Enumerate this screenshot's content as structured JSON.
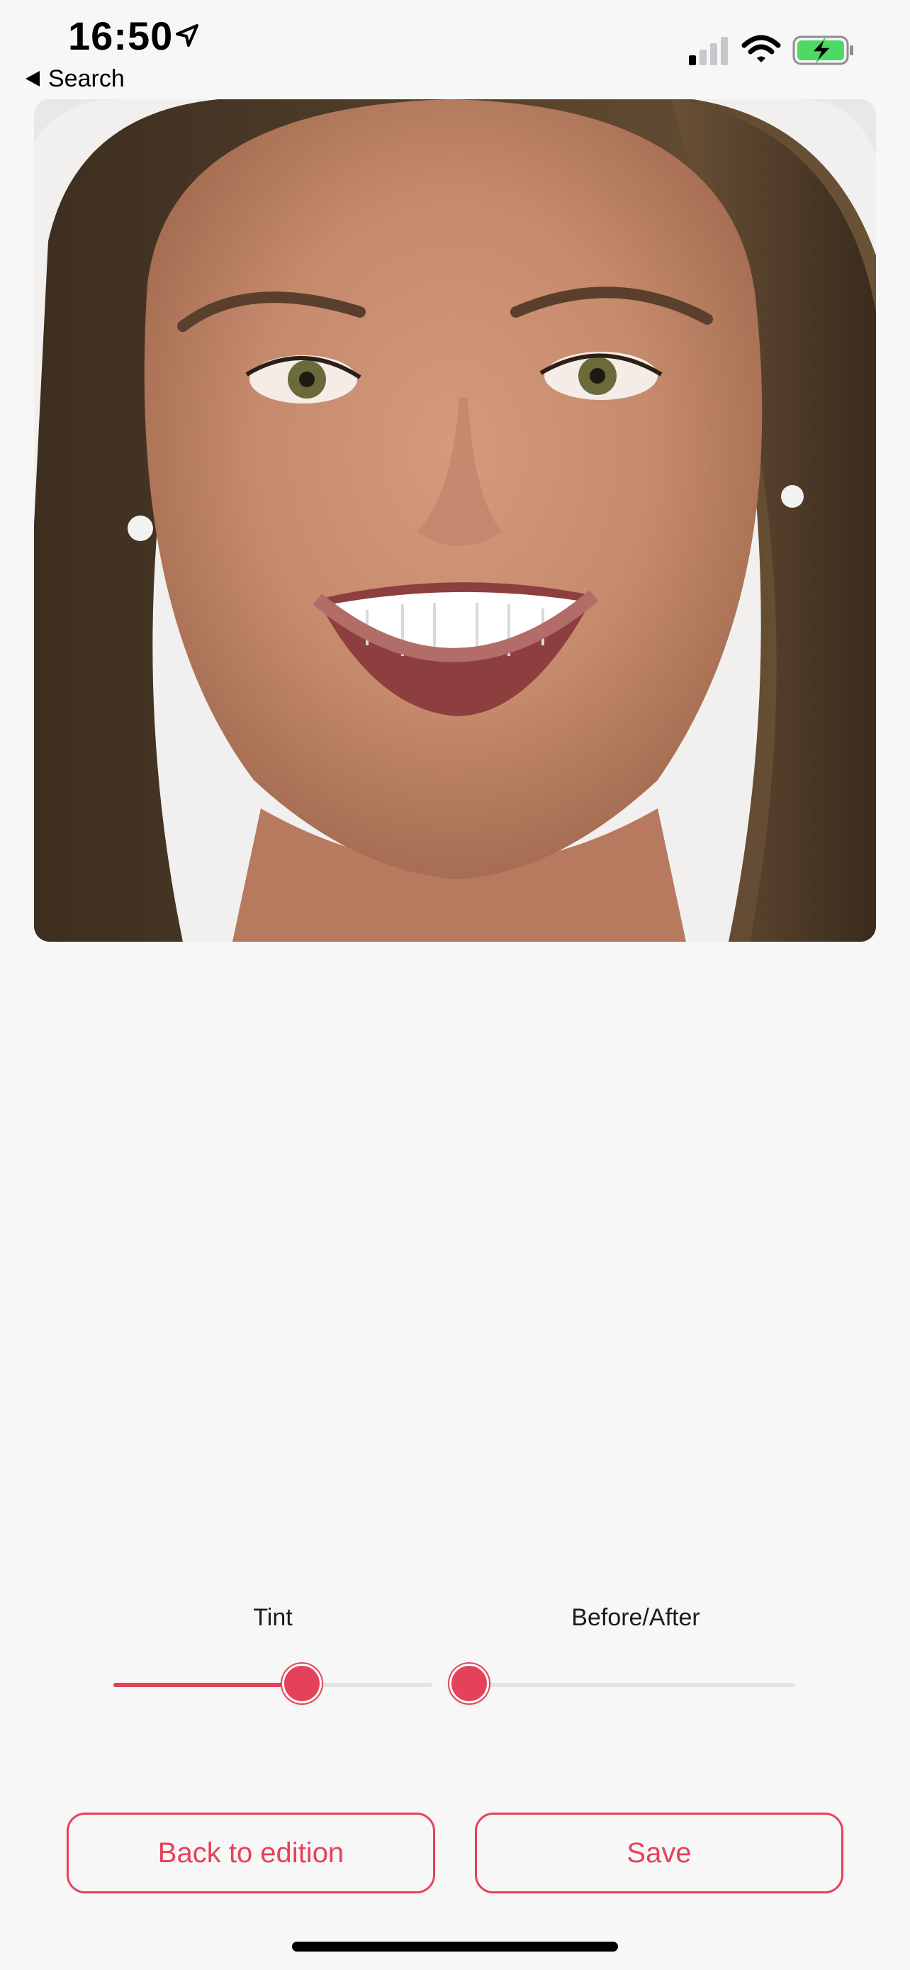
{
  "status_bar": {
    "time": "16:50",
    "back_label": "Search",
    "battery_color": "#4cd964"
  },
  "photo": {
    "alt": "Smiling woman portrait with whitened teeth"
  },
  "controls": {
    "tint": {
      "label": "Tint",
      "value": 0.59
    },
    "before_after": {
      "label": "Before/After",
      "value": 0.0
    }
  },
  "buttons": {
    "back_label": "Back to edition",
    "save_label": "Save"
  },
  "theme": {
    "accent": "#e5425a",
    "background": "#f7f7f7"
  }
}
